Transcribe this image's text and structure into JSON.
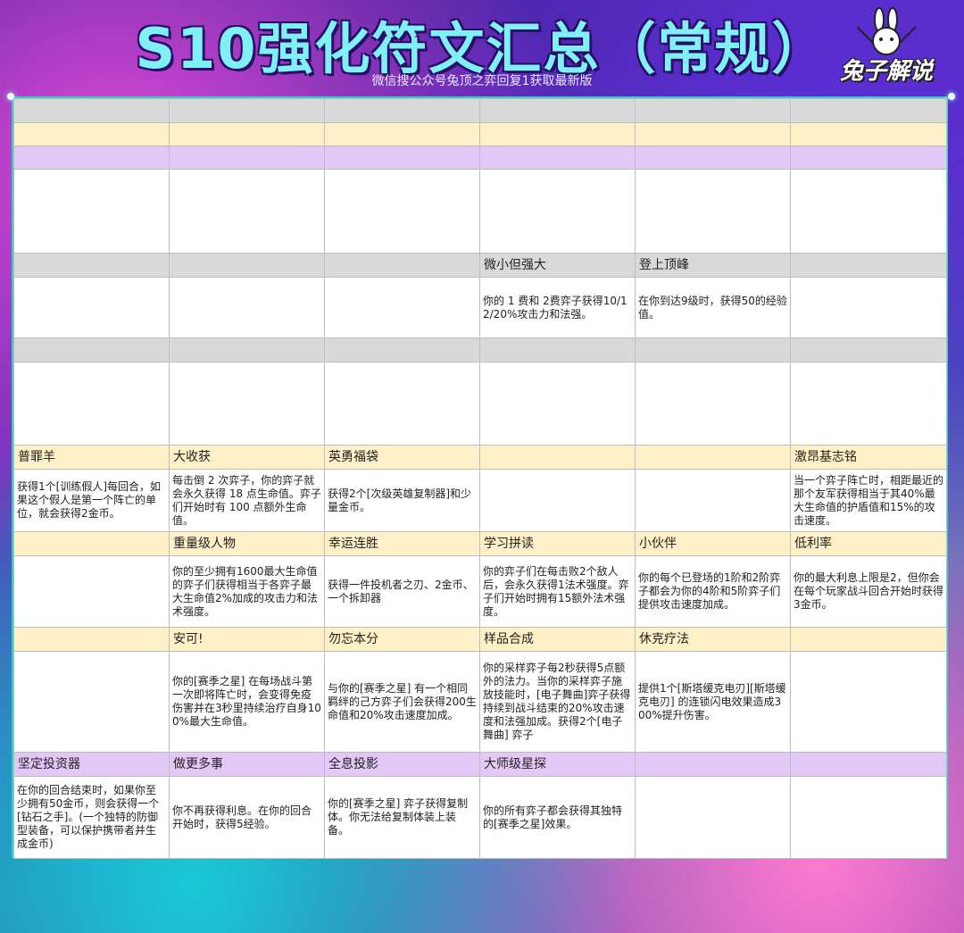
{
  "header": {
    "title": "S10强化符文汇总（常规）",
    "subtitle": "微信搜公众号兔顶之弈回复1获取最新版",
    "logo_text": "兔子解说"
  },
  "rows": [
    {
      "style": "gray",
      "h": 27,
      "cells": [
        "",
        "",
        "",
        "",
        "",
        ""
      ]
    },
    {
      "style": "cream",
      "h": 26,
      "cells": [
        "",
        "",
        "",
        "",
        "",
        ""
      ]
    },
    {
      "style": "lilac",
      "h": 26,
      "cells": [
        "",
        "",
        "",
        "",
        "",
        ""
      ]
    },
    {
      "style": "body",
      "h": 94,
      "cells": [
        "",
        "",
        "",
        "",
        "",
        ""
      ]
    },
    {
      "style": "gray",
      "h": 27,
      "cells": [
        "",
        "",
        "",
        "微小但强大",
        "登上顶峰",
        ""
      ]
    },
    {
      "style": "body",
      "h": 68,
      "cells": [
        "",
        "",
        "",
        "你的 1 费和 2费弈子获得10/12/20%攻击力和法强。",
        "在你到达9级时，获得50的经验值。",
        ""
      ]
    },
    {
      "style": "gray",
      "h": 27,
      "cells": [
        "",
        "",
        "",
        "",
        "",
        ""
      ]
    },
    {
      "style": "body",
      "h": 93,
      "cells": [
        "",
        "",
        "",
        "",
        "",
        ""
      ]
    },
    {
      "style": "cream",
      "h": 27,
      "cells": [
        "普罪羊",
        "大收获",
        "英勇福袋",
        "",
        "",
        "激昂基志铭"
      ]
    },
    {
      "style": "body",
      "h": 70,
      "cells": [
        "获得1个[训练假人]每回合，如果这个假人是第一个阵亡的单位，就会获得2金币。",
        "每击倒 2 次弈子，你的弈子就会永久获得 18 点生命值。弈子们开始时有 100 点额外生命值。",
        "获得2个[次级英雄复制器]和少量金币。",
        "",
        "",
        "当一个弈子阵亡时，相距最近的那个友军获得相当于其40%最大生命值的护盾值和15%的攻击速度。"
      ]
    },
    {
      "style": "cream",
      "h": 27,
      "cells": [
        "",
        "重量级人物",
        "幸运连胜",
        "学习拼读",
        "小伙伴",
        "低利率"
      ]
    },
    {
      "style": "body",
      "h": 80,
      "cells": [
        "",
        "你的至少拥有1600最大生命值的弈子们获得相当于各弈子最大生命值2%加成的攻击力和法术强度。",
        "获得一件投机者之刃、2金币、一个拆卸器",
        "你的弈子们在每击败2个敌人后，会永久获得1法术强度。弈子们开始时拥有15额外法术强度。",
        "你的每个已登场的1阶和2阶弈子都会为你的4阶和5阶弈子们提供攻击速度加成。",
        "你的最大利息上限是2，但你会在每个玩家战斗回合开始时获得3金币。"
      ]
    },
    {
      "style": "cream",
      "h": 27,
      "cells": [
        "",
        "安可!",
        "勿忘本分",
        "样品合成",
        "休克疗法",
        ""
      ]
    },
    {
      "style": "body",
      "h": 113,
      "cells": [
        "",
        "你的[赛季之星] 在每场战斗第一次即将阵亡时，会变得免疫伤害并在3秒里持续治疗自身100%最大生命值。",
        "与你的[赛季之星] 有一个相同羁绊的己方弈子们会获得200生命值和20%攻击速度加成。",
        "你的采样弈子每2秒获得5点额外的法力。当你的采样弈子施放技能时，[电子舞曲]弈子获得持续到战斗结束的20%攻击速度和法强加成。获得2个[电子舞曲] 弈子",
        "提供1个[斯塔缓克电刃][斯塔缓克电刃] 的连锁闪电效果造成300%提升伤害。",
        ""
      ]
    },
    {
      "style": "lilac",
      "h": 27,
      "cells": [
        "坚定投资器",
        "做更多事",
        "全息投影",
        "大师级星探",
        "",
        ""
      ]
    },
    {
      "style": "body",
      "h": 92,
      "cells": [
        "在你的回合结束时，如果你至少拥有50金币，则会获得一个[钻石之手]。(一个独特的防御型装备，可以保护携带者并生成金币)",
        "你不再获得利息。在你的回合开始时，获得5经验。",
        "你的[赛季之星] 弈子获得复制体。你无法给复制体装上装备。",
        "你的所有弈子都会获得其独特的[赛季之星]效果。",
        "",
        ""
      ]
    }
  ]
}
